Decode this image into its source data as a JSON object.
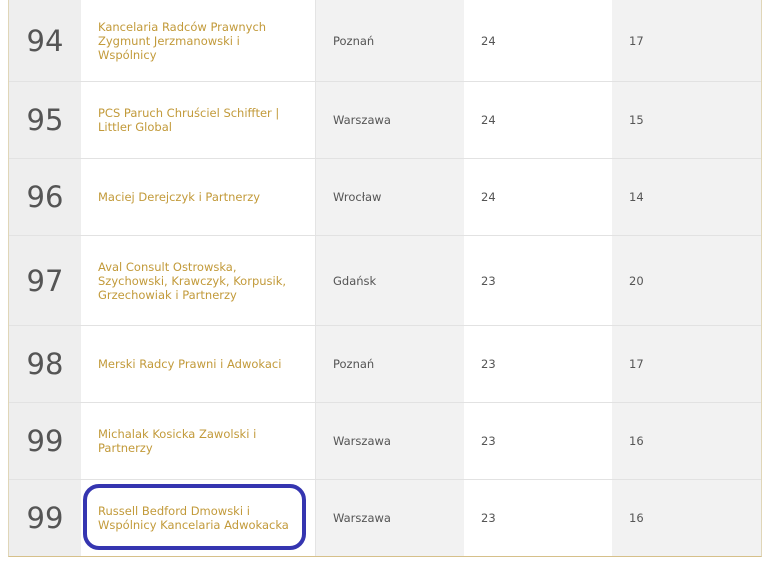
{
  "rows": [
    {
      "rank": "94",
      "name": "Kancelaria Radców Prawnych Zygmunt Jerzmanowski i Wspólnicy",
      "city": "Poznań",
      "col1": "24",
      "col2": "17"
    },
    {
      "rank": "95",
      "name": "PCS Paruch Chruściel Schiffter | Littler Global",
      "city": "Warszawa",
      "col1": "24",
      "col2": "15"
    },
    {
      "rank": "96",
      "name": "Maciej Derejczyk i Partnerzy",
      "city": "Wrocław",
      "col1": "24",
      "col2": "14"
    },
    {
      "rank": "97",
      "name": "Aval Consult Ostrowska, Szychowski, Krawczyk, Korpusik, Grzechowiak i Partnerzy",
      "city": "Gdańsk",
      "col1": "23",
      "col2": "20"
    },
    {
      "rank": "98",
      "name": "Merski Radcy Prawni i Adwokaci",
      "city": "Poznań",
      "col1": "23",
      "col2": "17"
    },
    {
      "rank": "99",
      "name": "Michalak Kosicka Zawolski i Partnerzy",
      "city": "Warszawa",
      "col1": "23",
      "col2": "16"
    },
    {
      "rank": "99",
      "name": "Russell Bedford Dmowski i Wspólnicy Kancelaria Adwokacka",
      "city": "Warszawa",
      "col1": "23",
      "col2": "16"
    }
  ],
  "accent_color": "#c29a3a",
  "highlight_color": "#3535b0"
}
